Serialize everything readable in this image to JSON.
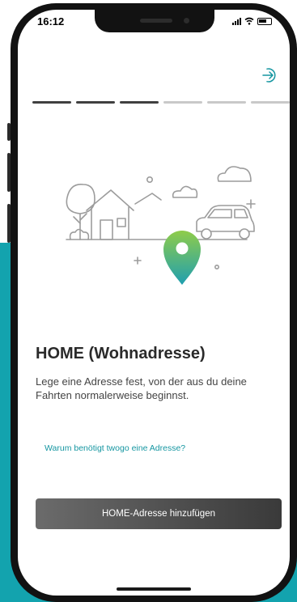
{
  "status_bar": {
    "time": "16:12"
  },
  "progress": {
    "total_steps": 6,
    "completed_steps": 3
  },
  "onboarding": {
    "title": "HOME (Wohnadresse)",
    "description": "Lege eine Adresse fest, von der aus du deine Fahrten normalerweise beginnst.",
    "link": "Warum benötigt twogo eine Adresse?",
    "cta": "HOME-Adresse hinzufügen"
  },
  "colors": {
    "teal": "#13a3ae",
    "pin_top": "#8fcc4a",
    "pin_bottom": "#1f9fb0"
  },
  "icons": [
    "exit-arrow-icon",
    "signal-icon",
    "wifi-icon",
    "battery-icon",
    "location-pin-icon"
  ]
}
